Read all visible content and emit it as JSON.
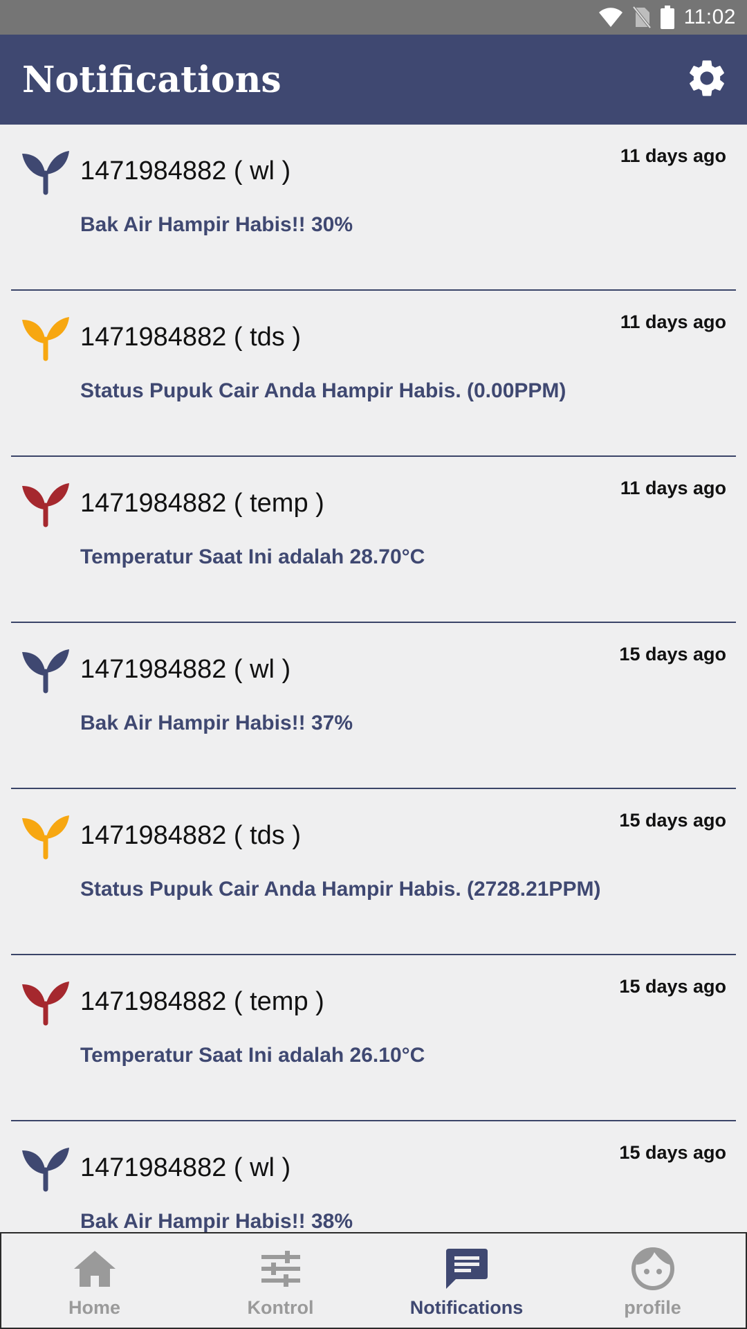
{
  "status_bar": {
    "time": "11:02",
    "icons": [
      "wifi-icon",
      "no-sim-icon",
      "battery-icon"
    ]
  },
  "app_bar": {
    "title": "Notifications",
    "settings_icon": "gear-icon"
  },
  "colors": {
    "primary": "#3f4871",
    "tds": "#f7a711",
    "temp": "#a5282e",
    "wl": "#3f4871"
  },
  "notifications": [
    {
      "title": "1471984882 ( wl )",
      "time": "11 days ago",
      "message": "Bak Air Hampir Habis!! 30%",
      "type": "wl"
    },
    {
      "title": "1471984882 ( tds )",
      "time": "11 days ago",
      "message": "Status Pupuk Cair Anda Hampir Habis. (0.00PPM)",
      "type": "tds"
    },
    {
      "title": "1471984882 ( temp )",
      "time": "11 days ago",
      "message": "Temperatur Saat Ini adalah 28.70°C",
      "type": "temp"
    },
    {
      "title": "1471984882 ( wl )",
      "time": "15 days ago",
      "message": "Bak Air Hampir Habis!! 37%",
      "type": "wl"
    },
    {
      "title": "1471984882 ( tds )",
      "time": "15 days ago",
      "message": "Status Pupuk Cair Anda Hampir Habis. (2728.21PPM)",
      "type": "tds"
    },
    {
      "title": "1471984882 ( temp )",
      "time": "15 days ago",
      "message": "Temperatur Saat Ini adalah 26.10°C",
      "type": "temp"
    },
    {
      "title": "1471984882 ( wl )",
      "time": "15 days ago",
      "message": "Bak Air Hampir Habis!! 38%",
      "type": "wl"
    }
  ],
  "bottom_nav": [
    {
      "label": "Home",
      "icon": "home-icon",
      "active": false
    },
    {
      "label": "Kontrol",
      "icon": "sliders-icon",
      "active": false
    },
    {
      "label": "Notifications",
      "icon": "message-icon",
      "active": true
    },
    {
      "label": "profile",
      "icon": "face-icon",
      "active": false
    }
  ]
}
